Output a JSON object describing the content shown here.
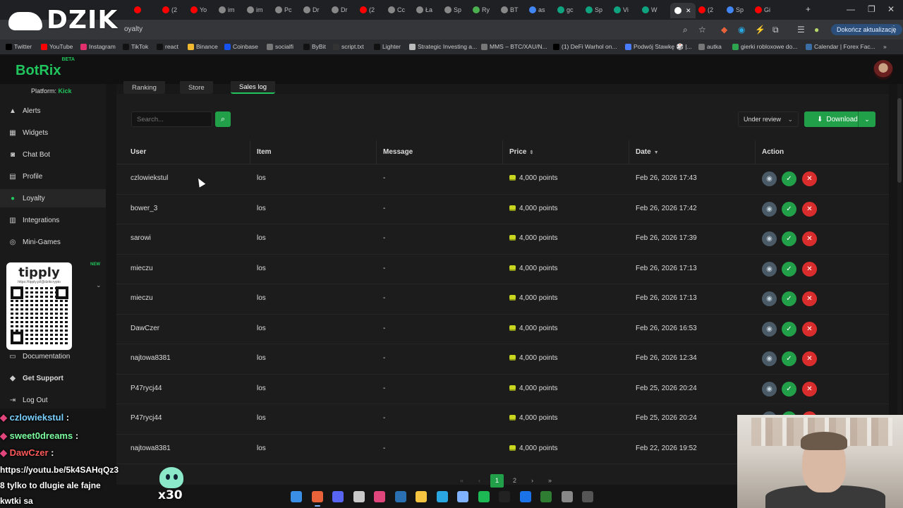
{
  "browser": {
    "url": "oyalty",
    "update_label": "Dokończ aktualizację",
    "tabs": [
      {
        "label": "",
        "color": "#ff0000"
      },
      {
        "label": "(2",
        "color": "#ff0000"
      },
      {
        "label": "Yo",
        "color": "#ff0000"
      },
      {
        "label": "im",
        "color": "#888888"
      },
      {
        "label": "im",
        "color": "#888888"
      },
      {
        "label": "Pc",
        "color": "#888888"
      },
      {
        "label": "Dr",
        "color": "#888888"
      },
      {
        "label": "Dr",
        "color": "#888888"
      },
      {
        "label": "(2",
        "color": "#ff0000"
      },
      {
        "label": "Cc",
        "color": "#888888"
      },
      {
        "label": "Ła",
        "color": "#888888"
      },
      {
        "label": "Sp",
        "color": "#888888"
      },
      {
        "label": "Ry",
        "color": "#4caf50"
      },
      {
        "label": "BT",
        "color": "#888888"
      },
      {
        "label": "as",
        "color": "#4285f4"
      },
      {
        "label": "gc",
        "color": "#10a37f"
      },
      {
        "label": "Sp",
        "color": "#10a37f"
      },
      {
        "label": "Vi",
        "color": "#10a37f"
      },
      {
        "label": "W",
        "color": "#10a37f"
      },
      {
        "label": "",
        "color": "#ffffff"
      },
      {
        "label": "(2",
        "color": "#ff0000"
      },
      {
        "label": "Sp",
        "color": "#4285f4"
      },
      {
        "label": "Gi",
        "color": "#ff0000"
      }
    ],
    "bookmarks": [
      {
        "label": "Twitter",
        "color": "#000000"
      },
      {
        "label": "YouTube",
        "color": "#ff0000"
      },
      {
        "label": "Instagram",
        "color": "#e1306c"
      },
      {
        "label": "TikTok",
        "color": "#111111"
      },
      {
        "label": "react",
        "color": "#111111"
      },
      {
        "label": "Binance",
        "color": "#f3ba2f"
      },
      {
        "label": "Coinbase",
        "color": "#1652f0"
      },
      {
        "label": "socialfi",
        "color": "#777777"
      },
      {
        "label": "ByBit",
        "color": "#111111"
      },
      {
        "label": "script.txt",
        "color": "#333333"
      },
      {
        "label": "Lighter",
        "color": "#111111"
      },
      {
        "label": "Strategic Investing a...",
        "color": "#bbbbbb"
      },
      {
        "label": "MMS – BTC/XAU/N...",
        "color": "#777777"
      },
      {
        "label": "(1) DeFi Warhol on...",
        "color": "#000000"
      },
      {
        "label": "Podwój Stawkę 🎲 |...",
        "color": "#4a7cff"
      },
      {
        "label": "autka",
        "color": "#777777"
      },
      {
        "label": "gierki robloxowe do...",
        "color": "#2ea44f"
      },
      {
        "label": "Calendar | Forex Fac...",
        "color": "#3a6ea5"
      }
    ]
  },
  "overlay": {
    "logo_text": "DZIK",
    "tipply_title": "tipply",
    "tipply_url": "https://tipply.pl/@dzikcrypto",
    "mascot_count": "x30"
  },
  "app": {
    "brand": "BotRix",
    "brand_badge": "BETA",
    "platform_label": "Platform:",
    "platform_value": "Kick"
  },
  "sidebar": {
    "items": [
      {
        "label": "Alerts",
        "icon": "alert-icon"
      },
      {
        "label": "Widgets",
        "icon": "grid-icon"
      },
      {
        "label": "Chat Bot",
        "icon": "robot-icon"
      },
      {
        "label": "Profile",
        "icon": "card-icon"
      },
      {
        "label": "Loyalty",
        "icon": "coin-icon"
      },
      {
        "label": "Integrations",
        "icon": "table-icon"
      },
      {
        "label": "Mini-Games",
        "icon": "gamepad-icon"
      },
      {
        "label": "Documentation",
        "icon": "doc-icon"
      },
      {
        "label": "Get Support",
        "icon": "support-icon"
      },
      {
        "label": "Log Out",
        "icon": "logout-icon"
      }
    ],
    "new_badge": "NEW"
  },
  "tabs": {
    "ranking": "Ranking",
    "store": "Store",
    "sales_log": "Sales log"
  },
  "toolbar": {
    "search_placeholder": "Search...",
    "status_value": "Under review",
    "download_label": "Download"
  },
  "table": {
    "headers": {
      "user": "User",
      "item": "Item",
      "message": "Message",
      "price": "Price",
      "date": "Date",
      "action": "Action"
    },
    "rows": [
      {
        "user": "czlowiekstul",
        "item": "los",
        "message": "-",
        "price": "4,000 points",
        "date": "Feb 26, 2026 17:43"
      },
      {
        "user": "bower_3",
        "item": "los",
        "message": "-",
        "price": "4,000 points",
        "date": "Feb 26, 2026 17:42"
      },
      {
        "user": "sarowi",
        "item": "los",
        "message": "-",
        "price": "4,000 points",
        "date": "Feb 26, 2026 17:39"
      },
      {
        "user": "mieczu",
        "item": "los",
        "message": "-",
        "price": "4,000 points",
        "date": "Feb 26, 2026 17:13"
      },
      {
        "user": "mieczu",
        "item": "los",
        "message": "-",
        "price": "4,000 points",
        "date": "Feb 26, 2026 17:13"
      },
      {
        "user": "DawCzer",
        "item": "los",
        "message": "-",
        "price": "4,000 points",
        "date": "Feb 26, 2026 16:53"
      },
      {
        "user": "najtowa8381",
        "item": "los",
        "message": "-",
        "price": "4,000 points",
        "date": "Feb 26, 2026 12:34"
      },
      {
        "user": "P47rycj44",
        "item": "los",
        "message": "-",
        "price": "4,000 points",
        "date": "Feb 25, 2026 20:24"
      },
      {
        "user": "P47rycj44",
        "item": "los",
        "message": "-",
        "price": "4,000 points",
        "date": "Feb 25, 2026 20:24"
      },
      {
        "user": "najtowa8381",
        "item": "los",
        "message": "-",
        "price": "4,000 points",
        "date": "Feb 22, 2026 19:52"
      }
    ]
  },
  "pagination": {
    "first": "«",
    "prev": "‹",
    "page1": "1",
    "page2": "2",
    "next": "›",
    "last": "»"
  },
  "chat": [
    {
      "user": "czlowiekstul",
      "text": "",
      "color": "#7ad0ff"
    },
    {
      "user": "sweet0dreams",
      "text": "",
      "color": "#7dffa0"
    },
    {
      "user": "DawCzer",
      "text": "",
      "color": "#ff5a5a"
    },
    {
      "user": "",
      "text": "https://youtu.be/5k4SAHqQz3",
      "color": "#ffffff"
    },
    {
      "user": "",
      "text": "8 tylko to dlugie ale fajne",
      "color": "#ffffff"
    },
    {
      "user": "",
      "text": "kwtki sa",
      "color": "#ffffff"
    }
  ],
  "colors": {
    "accent": "#21c55d",
    "approve": "#21a049",
    "reject": "#d92c2c",
    "view": "#4a5a66"
  }
}
